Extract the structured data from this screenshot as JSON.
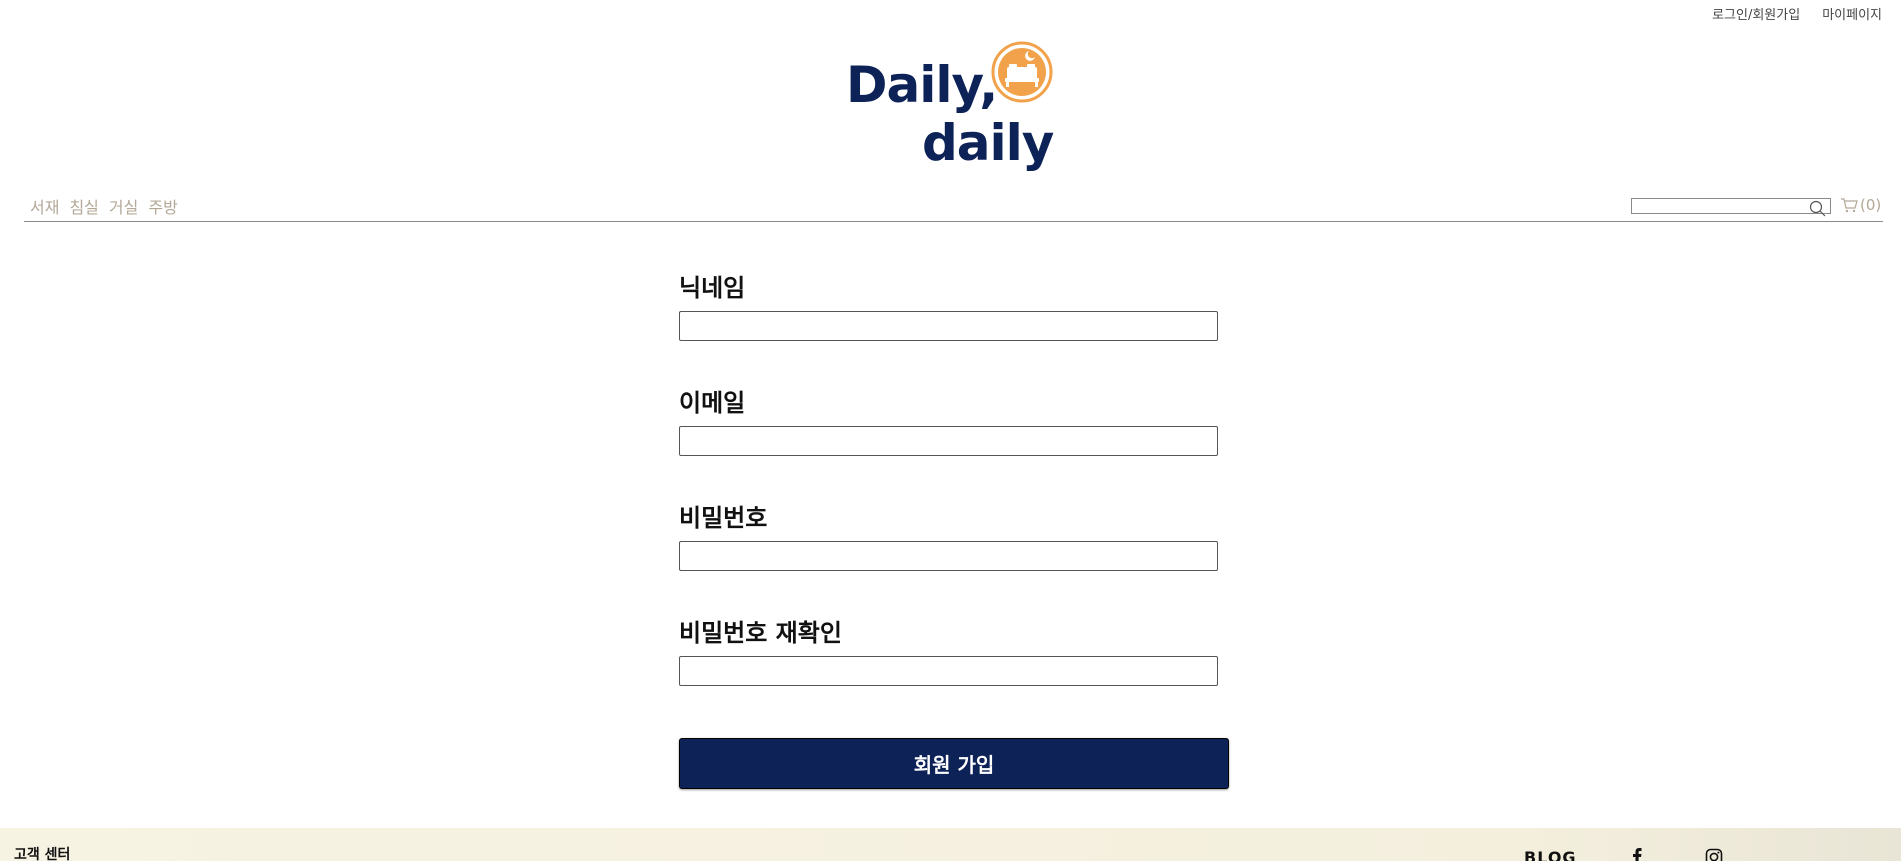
{
  "top_links": {
    "login": "로그인/회원가입",
    "mypage": "마이페이지"
  },
  "logo": {
    "line1": "Daily,",
    "line2": "daily",
    "icon": "bed-moon-icon",
    "colors": {
      "text": "#0d2257",
      "icon": "#f2a24a"
    }
  },
  "nav": {
    "categories": [
      "서재",
      "침실",
      "거실",
      "주방"
    ],
    "search_placeholder": "",
    "search_icon": "search-icon",
    "cart_icon": "cart-icon",
    "cart_count": "(0)"
  },
  "form": {
    "fields": [
      {
        "label": "닉네임",
        "value": ""
      },
      {
        "label": "이메일",
        "value": ""
      },
      {
        "label": "비밀번호",
        "value": ""
      },
      {
        "label": "비밀번호 재확인",
        "value": ""
      }
    ],
    "submit_label": "회원 가입"
  },
  "footer": {
    "title": "고객 센터",
    "blog": "BLOG",
    "facebook_icon": "facebook-icon",
    "instagram_icon": "instagram-icon"
  },
  "colors": {
    "primary": "#0d2257",
    "accent": "#f2a24a",
    "muted_text": "#b3a898",
    "footer_bg": "#f7f3e3"
  }
}
